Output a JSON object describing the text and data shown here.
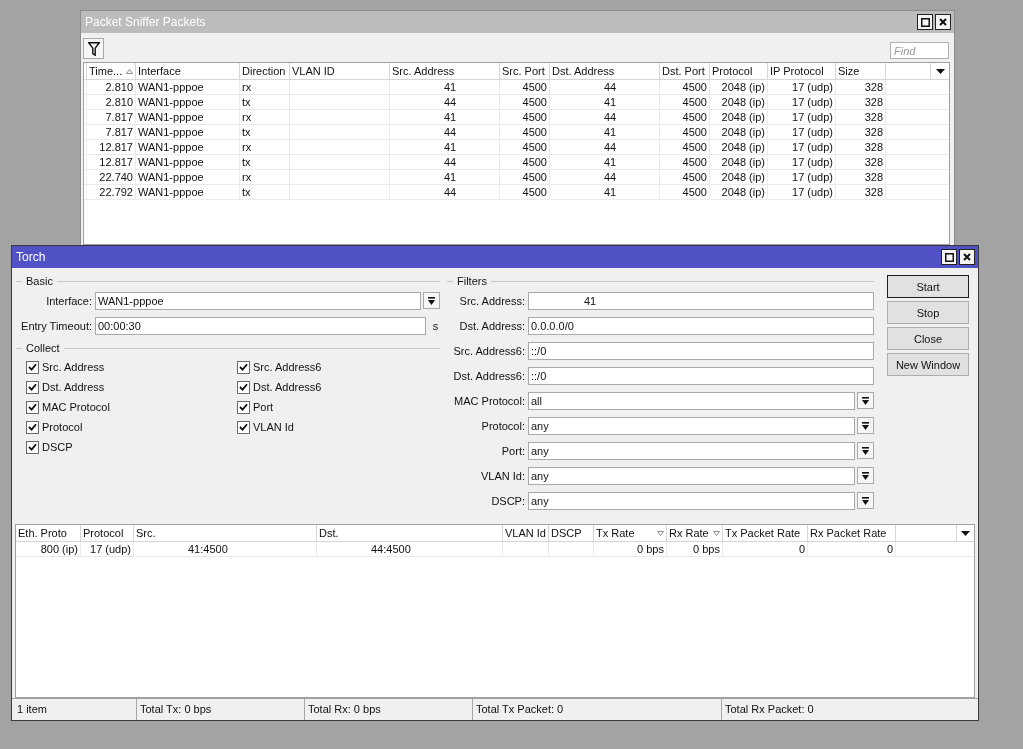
{
  "sniffer_window": {
    "title": "Packet Sniffer Packets",
    "active": false,
    "search": {
      "placeholder": "Find"
    },
    "table": {
      "columns": [
        {
          "label": "Time...",
          "sort_ascending": true,
          "sort_descending": false
        },
        {
          "label": "Interface",
          "sort_ascending": false,
          "sort_descending": false
        },
        {
          "label": "Direction",
          "sort_ascending": false,
          "sort_descending": false
        },
        {
          "label": "VLAN ID",
          "sort_ascending": false,
          "sort_descending": false
        },
        {
          "label": "Src. Address",
          "sort_ascending": false,
          "sort_descending": false
        },
        {
          "label": "Src. Port",
          "sort_ascending": false,
          "sort_descending": false
        },
        {
          "label": "Dst. Address",
          "sort_ascending": false,
          "sort_descending": false
        },
        {
          "label": "Dst. Port",
          "sort_ascending": false,
          "sort_descending": false
        },
        {
          "label": "Protocol",
          "sort_ascending": false,
          "sort_descending": false
        },
        {
          "label": "IP Protocol",
          "sort_ascending": false,
          "sort_descending": false
        },
        {
          "label": "Size",
          "sort_ascending": false,
          "sort_descending": false
        }
      ],
      "rows": [
        {
          "time": "2.810",
          "interface": "WAN1-pppoe",
          "direction": "rx",
          "src_address": "41",
          "src_port": "4500",
          "dst_address": "44",
          "dst_port": "4500",
          "protocol": "2048 (ip)",
          "ip_protocol": "17 (udp)",
          "size": "328"
        },
        {
          "time": "2.810",
          "interface": "WAN1-pppoe",
          "direction": "tx",
          "src_address": "44",
          "src_port": "4500",
          "dst_address": "41",
          "dst_port": "4500",
          "protocol": "2048 (ip)",
          "ip_protocol": "17 (udp)",
          "size": "328"
        },
        {
          "time": "7.817",
          "interface": "WAN1-pppoe",
          "direction": "rx",
          "src_address": "41",
          "src_port": "4500",
          "dst_address": "44",
          "dst_port": "4500",
          "protocol": "2048 (ip)",
          "ip_protocol": "17 (udp)",
          "size": "328"
        },
        {
          "time": "7.817",
          "interface": "WAN1-pppoe",
          "direction": "tx",
          "src_address": "44",
          "src_port": "4500",
          "dst_address": "41",
          "dst_port": "4500",
          "protocol": "2048 (ip)",
          "ip_protocol": "17 (udp)",
          "size": "328"
        },
        {
          "time": "12.817",
          "interface": "WAN1-pppoe",
          "direction": "rx",
          "src_address": "41",
          "src_port": "4500",
          "dst_address": "44",
          "dst_port": "4500",
          "protocol": "2048 (ip)",
          "ip_protocol": "17 (udp)",
          "size": "328"
        },
        {
          "time": "12.817",
          "interface": "WAN1-pppoe",
          "direction": "tx",
          "src_address": "44",
          "src_port": "4500",
          "dst_address": "41",
          "dst_port": "4500",
          "protocol": "2048 (ip)",
          "ip_protocol": "17 (udp)",
          "size": "328"
        },
        {
          "time": "22.740",
          "interface": "WAN1-pppoe",
          "direction": "rx",
          "src_address": "41",
          "src_port": "4500",
          "dst_address": "44",
          "dst_port": "4500",
          "protocol": "2048 (ip)",
          "ip_protocol": "17 (udp)",
          "size": "328"
        },
        {
          "time": "22.792",
          "interface": "WAN1-pppoe",
          "direction": "tx",
          "src_address": "44",
          "src_port": "4500",
          "dst_address": "41",
          "dst_port": "4500",
          "protocol": "2048 (ip)",
          "ip_protocol": "17 (udp)",
          "size": "328"
        }
      ]
    }
  },
  "torch_window": {
    "title": "Torch",
    "active": true,
    "basic": {
      "title": "Basic",
      "interface": {
        "label": "Interface:",
        "value": "WAN1-pppoe"
      },
      "entry_timeout": {
        "label": "Entry Timeout:",
        "value": "00:00:30",
        "unit": "s"
      }
    },
    "collect": {
      "title": "Collect",
      "items": [
        {
          "label": "Src. Address",
          "checked": true
        },
        {
          "label": "Src. Address6",
          "checked": true
        },
        {
          "label": "Dst. Address",
          "checked": true
        },
        {
          "label": "Dst. Address6",
          "checked": true
        },
        {
          "label": "MAC Protocol",
          "checked": true
        },
        {
          "label": "Port",
          "checked": true
        },
        {
          "label": "Protocol",
          "checked": true
        },
        {
          "label": "VLAN Id",
          "checked": true
        },
        {
          "label": "DSCP",
          "checked": true
        }
      ]
    },
    "filters": {
      "title": "Filters",
      "fields": [
        {
          "label": "Src. Address:",
          "value": "41",
          "kind": "text"
        },
        {
          "label": "Dst. Address:",
          "value": "0.0.0.0/0",
          "kind": "text"
        },
        {
          "label": "Src. Address6:",
          "value": "::/0",
          "kind": "text"
        },
        {
          "label": "Dst. Address6:",
          "value": "::/0",
          "kind": "text"
        },
        {
          "label": "MAC Protocol:",
          "value": "all",
          "kind": "select"
        },
        {
          "label": "Protocol:",
          "value": "any",
          "kind": "select"
        },
        {
          "label": "Port:",
          "value": "any",
          "kind": "select"
        },
        {
          "label": "VLAN Id:",
          "value": "any",
          "kind": "select"
        },
        {
          "label": "DSCP:",
          "value": "any",
          "kind": "select"
        }
      ]
    },
    "buttons": [
      {
        "label": "Start",
        "default": true
      },
      {
        "label": "Stop",
        "default": false
      },
      {
        "label": "Close",
        "default": false
      },
      {
        "label": "New Window",
        "default": false
      }
    ],
    "table": {
      "columns": [
        {
          "label": "Eth. Proto",
          "sort_ascending": false,
          "sort_descending": false
        },
        {
          "label": "Protocol",
          "sort_ascending": false,
          "sort_descending": false
        },
        {
          "label": "Src.",
          "sort_ascending": false,
          "sort_descending": false
        },
        {
          "label": "Dst.",
          "sort_ascending": false,
          "sort_descending": false
        },
        {
          "label": "VLAN Id",
          "sort_ascending": false,
          "sort_descending": false
        },
        {
          "label": "DSCP",
          "sort_ascending": false,
          "sort_descending": false
        },
        {
          "label": "Tx Rate",
          "sort_ascending": false,
          "sort_descending": true
        },
        {
          "label": "Rx Rate",
          "sort_ascending": false,
          "sort_descending": true
        },
        {
          "label": "Tx Packet Rate",
          "sort_ascending": false,
          "sort_descending": false
        },
        {
          "label": "Rx Packet Rate",
          "sort_ascending": false,
          "sort_descending": false
        }
      ],
      "rows": [
        {
          "eth_proto": "800 (ip)",
          "protocol": "17 (udp)",
          "src": "41:4500",
          "dst": "44:4500",
          "tx_rate": "0 bps",
          "rx_rate": "0 bps",
          "tx_packet_rate": "0",
          "rx_packet_rate": "0"
        }
      ]
    },
    "status_bar": [
      "1 item",
      "Total Tx: 0 bps",
      "Total Rx: 0 bps",
      "Total Tx Packet: 0",
      "Total Rx Packet: 0"
    ]
  }
}
